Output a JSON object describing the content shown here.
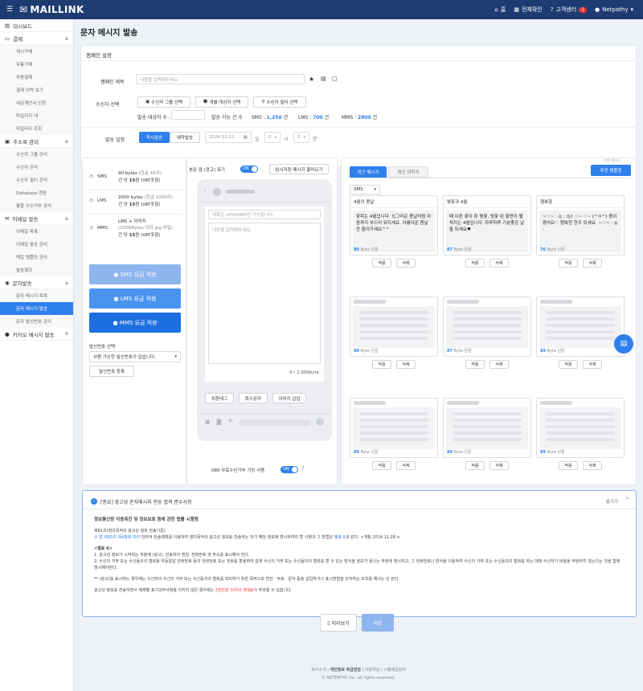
{
  "topbar": {
    "brand": "MAILLINK",
    "home": "홈",
    "notice": "전체확인",
    "support": "고객센터",
    "support_badge": "1",
    "user": "Netpathy"
  },
  "sidebar": {
    "dashboard": "대시보드",
    "payment": {
      "label": "결제",
      "items": [
        "캐시구매",
        "무통구매",
        "자동결제",
        "결제 이력 보기",
        "세금계산서 신청",
        "마일리지 내",
        "마일리지 조회"
      ]
    },
    "address": {
      "label": "주소록 관리",
      "items": [
        "수신자 그룹 관리",
        "수신자 관리",
        "수신자 필터 관리",
        "Database 연동",
        "통합 수신거부 관리"
      ]
    },
    "email": {
      "label": "이메일 발송",
      "items": [
        "이메일 목록",
        "이메일 발송 관리",
        "메일 템플릿 관리",
        "발송결과"
      ]
    },
    "sms": {
      "label": "문자발송",
      "items": [
        "문자 메시지 목록",
        "문자 메시지 발송",
        "문자 발신번호 관리"
      ],
      "active": "문자 메시지 발송"
    },
    "kakao": {
      "label": "카카오 메시지 발송"
    }
  },
  "page": {
    "title": "문자 메시지 발송"
  },
  "campaign": {
    "section": "캠페인 설정",
    "title_label": "캠페인 제목",
    "title_placeholder": "내용을 입력해주세요.",
    "recipient_label": "수신자 선택",
    "group_btn": "수신자 그룹 선택",
    "individual_btn": "개별 대상자 선택",
    "filter_btn": "수신자 필터 선택",
    "target_count_label": "발송 대상자 수 :",
    "possible_label": "발송 가능 건 수",
    "sms_label": "SMS :",
    "sms_count": "1,256",
    "lms_label": "LMS :",
    "lms_count": "700",
    "mms_label": "MMS :",
    "mms_count": "2800",
    "unit": "건",
    "schedule_label": "발송 일정",
    "immediate": "즉시발송",
    "reserve": "예약발송",
    "date": "2024.12.25",
    "day_unit": "일",
    "hour": "0",
    "hour_unit": "시",
    "minute": "0",
    "minute_unit": "분"
  },
  "types": [
    {
      "name": "SMS",
      "line1": "90 bytes",
      "line1b": "(한글 45자)",
      "line2": "건 당",
      "price": "15",
      "line2b": "원 (VAT포함)"
    },
    {
      "name": "LMS",
      "line1": "2000 bytes",
      "line1b": "(한글 1000자)",
      "line2": "건 당",
      "price": "15",
      "line2b": "원 (VAT포함)"
    },
    {
      "name": "MMS",
      "line1": "LMS + 이미지",
      "line1b": "(200KBytes 이하 jpg 파일)",
      "line2": "건 당",
      "price": "15",
      "line2b": "원 (VAT포함)"
    }
  ],
  "apply": {
    "sms": "SMS 요금 적용",
    "lms": "LMS 요금 적용",
    "mms": "MMS 요금 적용"
  },
  "sender": {
    "label": "발신번호 선택",
    "select": "사용 가능한 발신번호가 없습니다.",
    "register": "발신번호 등록"
  },
  "editor": {
    "ad_label": "본문 앞 (광고) 표기",
    "toggle_on": "ON",
    "load_temp": "임시저장 메시지 불러오기",
    "subject_placeholder": "제목은 LMS/MMS만 가능합니다.",
    "body_placeholder": "내용을 입력해주세요.",
    "counter": "0 / 2,000byte",
    "special_tag": "치환태그",
    "special_char": "특수문자",
    "insert_image": "이미지 삽입",
    "reject_label": "080 무료수신거부 기능 사용"
  },
  "templates": {
    "tab_recent": "최근 메시지",
    "tab_image": "최근 이미지",
    "recommend_hint": "추천 메시지",
    "recommend_btn": "추천 템플릿",
    "filter": "SMS",
    "byte_unit": "Byte 단문",
    "apply": "적용",
    "delete": "삭제",
    "items": [
      {
        "title": "4월의 봄날",
        "body": "꽃피는 4월입니다. 싱그러운 봄날처럼 마음까지 부드러 워지세요. 아름다운 봄날 한 들어가세요^^",
        "bytes": "89"
      },
      {
        "title": "벚꽃과 4월",
        "body": "때 이른 꽃이 핀 벚꽃, 벚꽃 된 향연이 펼쳐지는 4월입니다. 하루하루 기분좋은 날들 되세요♥",
        "bytes": "87"
      },
      {
        "title": "행복함",
        "body": "~♡~ : ◎ : /)/) ♡~ ♡~ (^ㅁ^) 봄이 왔어요♡ 행복한 한주 되세요. ~♡~ : ◎ :",
        "bytes": "76"
      },
      {
        "title": "",
        "body": "",
        "bytes": "89"
      },
      {
        "title": "",
        "body": "",
        "bytes": "87"
      },
      {
        "title": "",
        "body": "",
        "bytes": "89"
      },
      {
        "title": "",
        "body": "",
        "bytes": "89"
      },
      {
        "title": "",
        "body": "",
        "bytes": "89"
      },
      {
        "title": "",
        "body": "",
        "bytes": "89"
      }
    ]
  },
  "notice": {
    "title": "[중요] 광고성 문자메시지 전송 법적 준수사항",
    "hide": "숨기기",
    "heading": "정보통신망 이용촉진 및 정보보호 등에 관한 법률 시행령",
    "p1": "제61조(영리목적의 광고성 정보 전송기준)",
    "p2a": "① 법 제50조 제4항에 따라",
    "p2b": "전자적 전송매체를 이용하여 영리목적의 광고성 정보를 전송하는 자가 해당 정보에 명시하여야 할 사항과 그 방법은",
    "p2c": "별표 6",
    "p2d": "과 같다. <개정 2014.11.28.>",
    "sub": "<별표 6>",
    "l1": "1. 광고성 정보가 시작되는 부분에 (광고), 전송자의 명칭, 전화번호 및 주소를 표시해야 한다.",
    "l2": "2. 수신의 거부 또는 수신동의의 철회용 자동응답 전화번호 등의 전화번호 또는 전화를 할용하여 쉽게 수신의 거부 또는 수신동의의 철회를 할 수 있는 방식을 정보가 끝나는 부분에 명시하고, 그 전화번호나 방식을 이용하여 수신의 거부 또는 수신동의의 철회를 하는 데에 수신자가 비용을 부담하지 않는다는 것을 함께 명시해야한다.",
    "l3": "** (광고)를 표시하는 경우에는 수신자의 수신의 거부 또는 수신동의의 철회를 회피하기 위한 목적으로 빈칸 · 부호 · 문자 등을 삽입하거나 표시방법을 조작하는 조치를 해서는 안 된다.",
    "l4a": "광고성 정보를 전송하면서 매체별 표기의무사항을 지키지 않은 경우에는",
    "l4b": "3천만원 이하의 과태료",
    "l4c": "가 부과될 수 있습니다."
  },
  "actions": {
    "preview": "미리보기",
    "save": "저장"
  },
  "footer": {
    "links": [
      "회사소개",
      "개인정보 취급방침",
      "이용약관",
      "스팸메일정책"
    ],
    "copyright": "© NETPATHY. inc. all rights reserved."
  }
}
